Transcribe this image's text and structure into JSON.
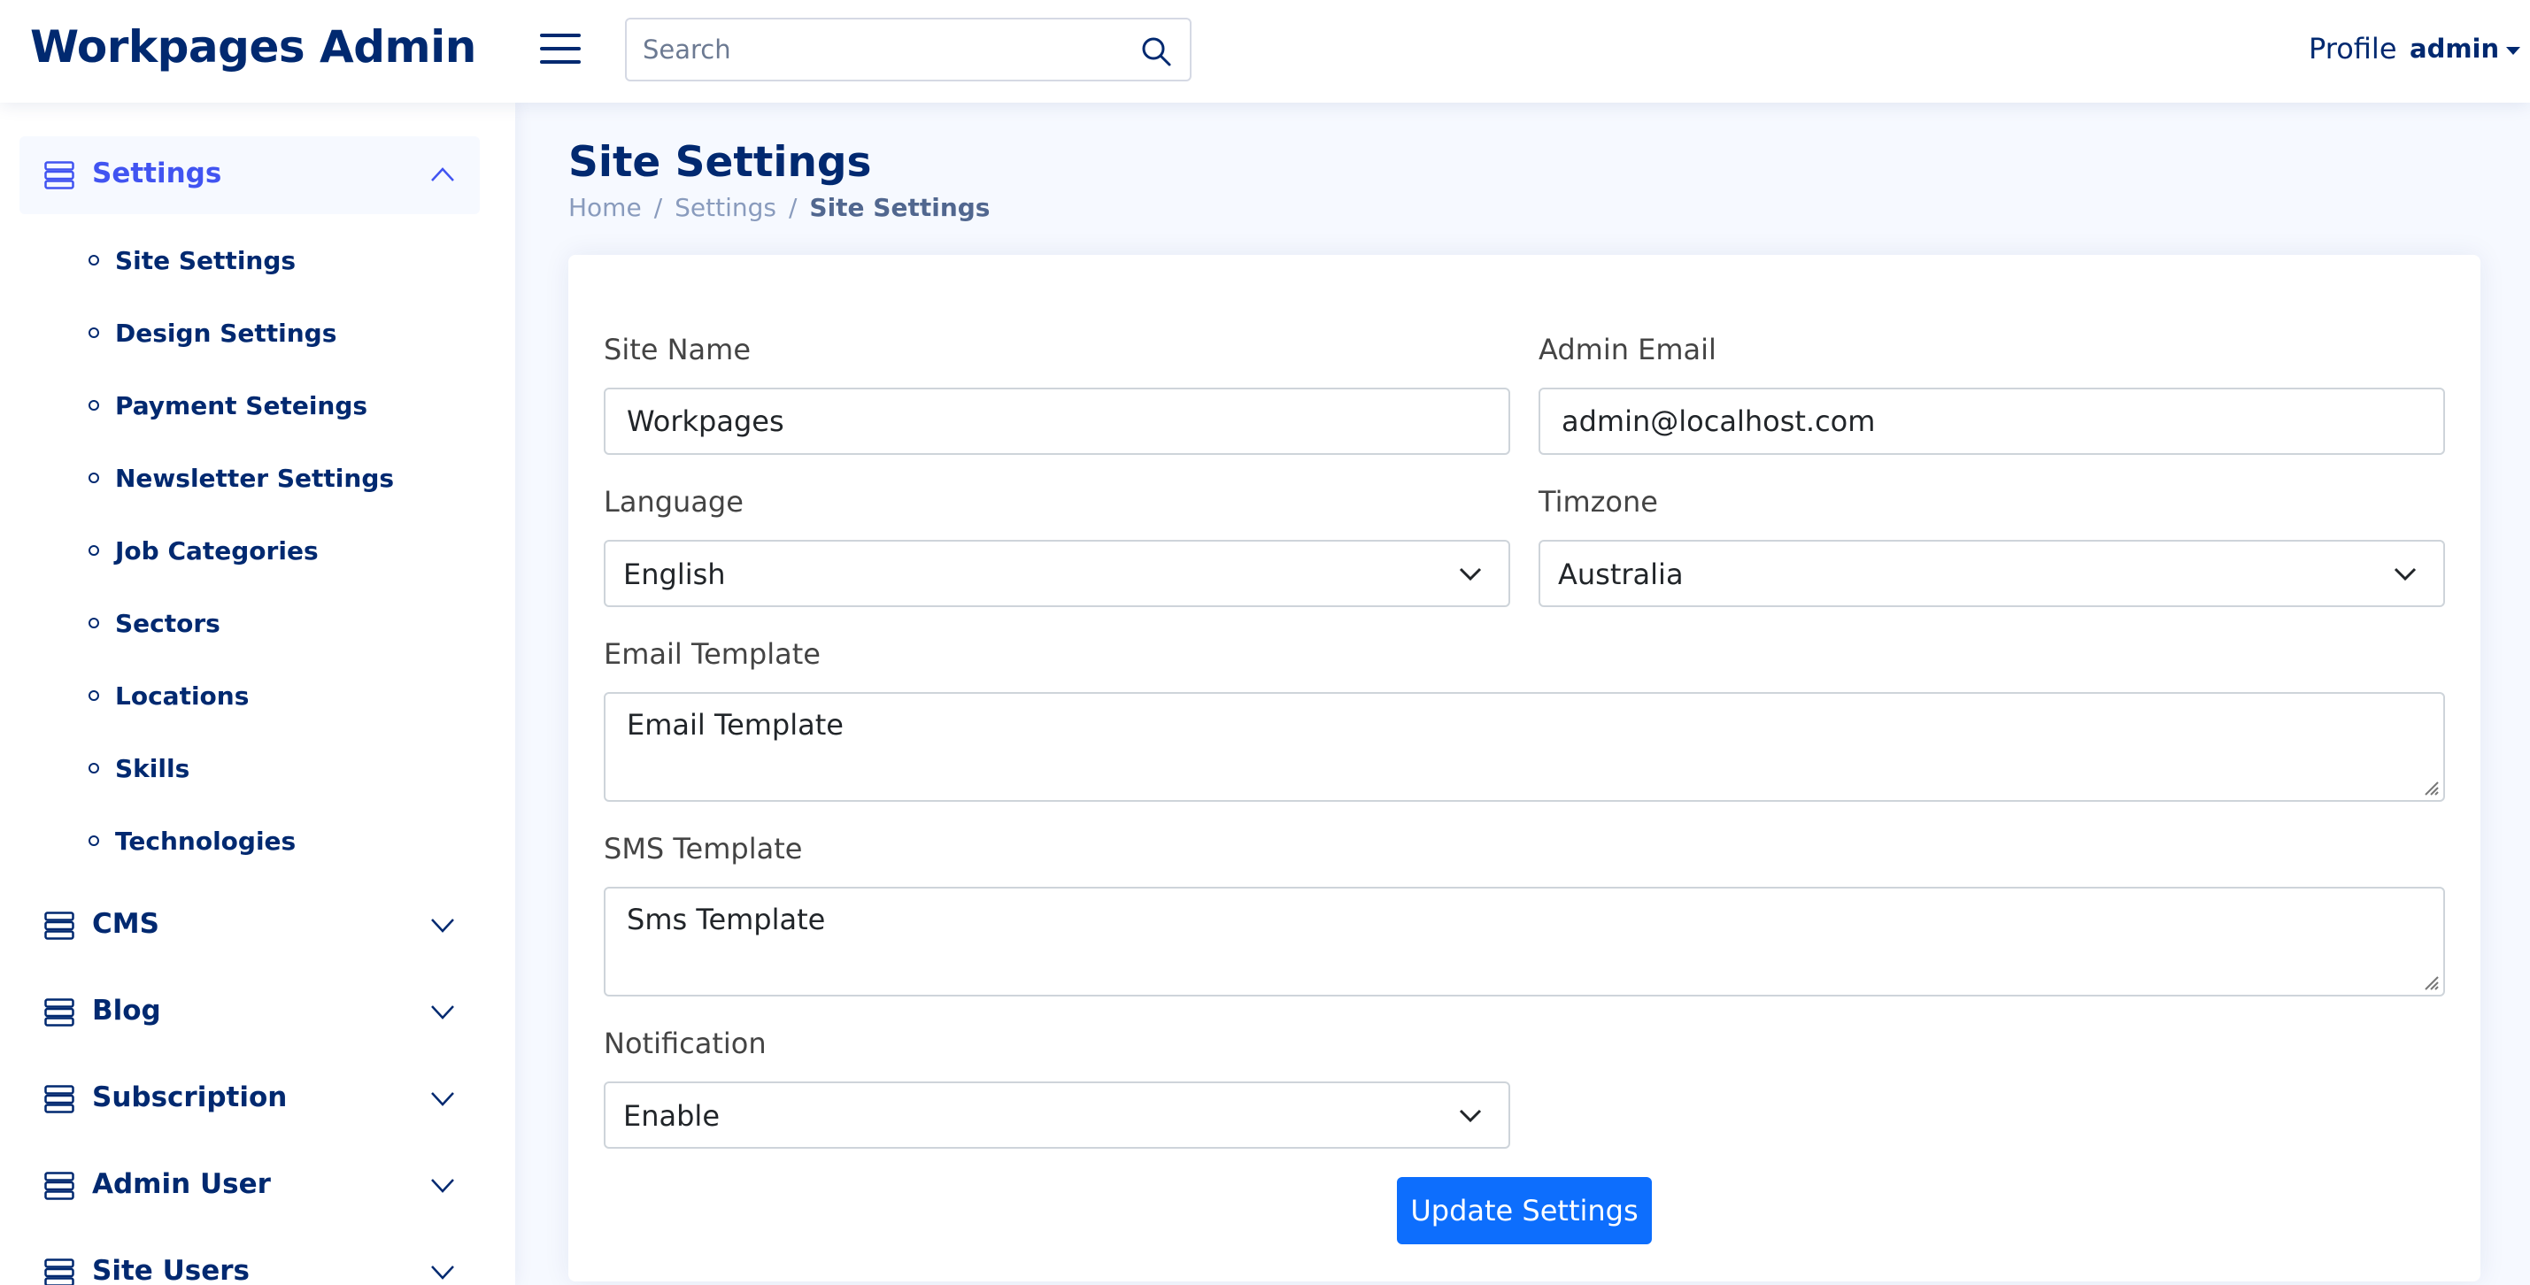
{
  "header": {
    "brand": "Workpages Admin",
    "search_placeholder": "Search",
    "profile_label": "Profile",
    "profile_user": "admin"
  },
  "sidebar": {
    "sections": [
      {
        "label": "Settings",
        "expanded": true,
        "icon": "server-icon"
      },
      {
        "label": "CMS",
        "expanded": false,
        "icon": "server-icon"
      },
      {
        "label": "Blog",
        "expanded": false,
        "icon": "server-icon"
      },
      {
        "label": "Subscription",
        "expanded": false,
        "icon": "server-icon"
      },
      {
        "label": "Admin User",
        "expanded": false,
        "icon": "server-icon"
      },
      {
        "label": "Site Users",
        "expanded": false,
        "icon": "server-icon"
      }
    ],
    "settings_items": [
      "Site Settings",
      "Design Settings",
      "Payment Seteings",
      "Newsletter Settings",
      "Job Categories",
      "Sectors",
      "Locations",
      "Skills",
      "Technologies"
    ]
  },
  "main": {
    "title": "Site Settings",
    "breadcrumb": [
      "Home",
      "Settings",
      "Site Settings"
    ],
    "breadcrumb_sep": "/"
  },
  "form": {
    "site_name": {
      "label": "Site Name",
      "value": "Workpages"
    },
    "admin_email": {
      "label": "Admin Email",
      "value": "admin@localhost.com"
    },
    "language": {
      "label": "Language",
      "value": "English"
    },
    "timezone": {
      "label": "Timzone",
      "value": "Australia"
    },
    "email_template": {
      "label": "Email Template",
      "value": "Email Template"
    },
    "sms_template": {
      "label": "SMS Template",
      "value": "Sms Template"
    },
    "notification": {
      "label": "Notification",
      "value": "Enable"
    },
    "submit_label": "Update Settings"
  },
  "colors": {
    "brand": "#012970",
    "accent": "#4154f1",
    "button": "#0d6efd",
    "background": "#f6f9ff"
  }
}
